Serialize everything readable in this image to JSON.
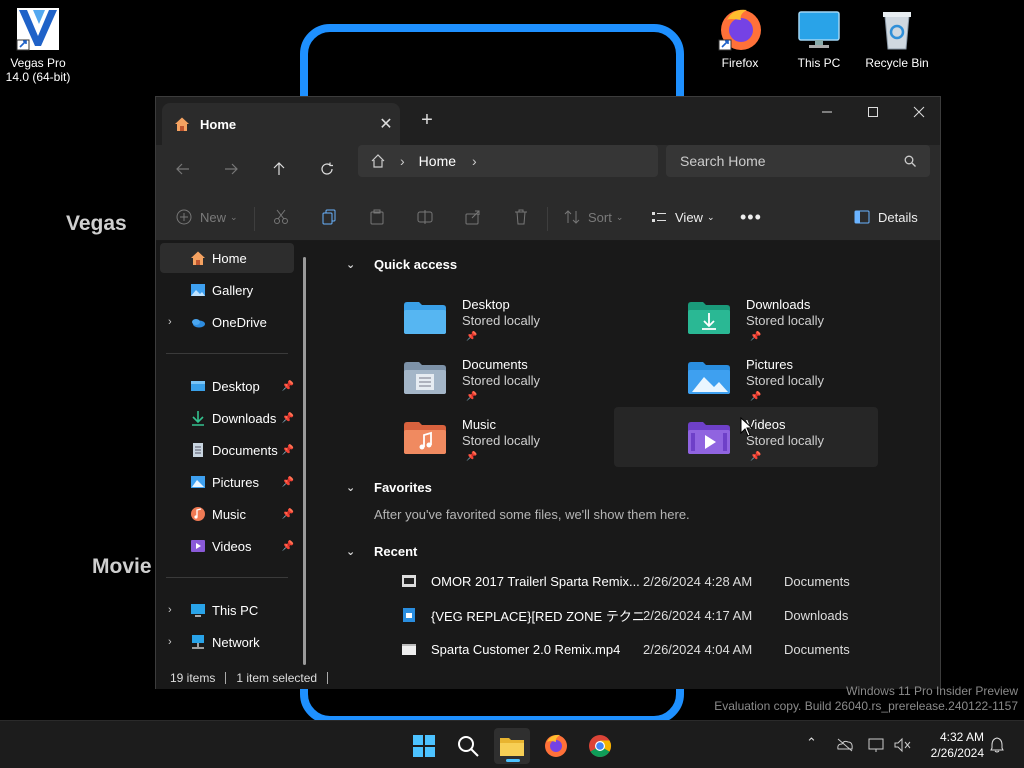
{
  "desktop": {
    "icons": {
      "vegas_label": "Vegas Pro\n14.0 (64-bit)",
      "vegas_line1": "Vegas Pro",
      "vegas_line2": "14.0 (64-bit)",
      "firefox": "Firefox",
      "this_pc": "This PC",
      "recycle_bin": "Recycle Bin"
    },
    "bg_text_vegas": "Vegas",
    "bg_text_movie": "Movie",
    "watermark_line1": "Windows 11 Pro Insider Preview",
    "watermark_line2": "Evaluation copy. Build 26040.rs_prerelease.240122-1157"
  },
  "window": {
    "tab_title": "Home",
    "breadcrumb_home": "Home",
    "search_placeholder": "Search Home",
    "commands": {
      "new": "New",
      "sort": "Sort",
      "view": "View",
      "details": "Details"
    }
  },
  "sidebar": {
    "items": [
      {
        "label": "Home",
        "icon": "home-icon"
      },
      {
        "label": "Gallery",
        "icon": "gallery-icon"
      },
      {
        "label": "OneDrive",
        "icon": "onedrive-icon"
      },
      {
        "label": "Desktop",
        "icon": "desktop-folder-icon"
      },
      {
        "label": "Downloads",
        "icon": "downloads-icon"
      },
      {
        "label": "Documents",
        "icon": "documents-icon"
      },
      {
        "label": "Pictures",
        "icon": "pictures-icon"
      },
      {
        "label": "Music",
        "icon": "music-icon"
      },
      {
        "label": "Videos",
        "icon": "videos-icon"
      },
      {
        "label": "This PC",
        "icon": "this-pc-icon"
      },
      {
        "label": "Network",
        "icon": "network-icon"
      }
    ]
  },
  "main": {
    "quick_access_title": "Quick access",
    "quick_access": [
      {
        "name": "Desktop",
        "sub": "Stored locally",
        "color": "#3aa0e8"
      },
      {
        "name": "Downloads",
        "sub": "Stored locally",
        "color": "#1fae8c"
      },
      {
        "name": "Documents",
        "sub": "Stored locally",
        "color": "#8fa6bf"
      },
      {
        "name": "Pictures",
        "sub": "Stored locally",
        "color": "#3ea0f0"
      },
      {
        "name": "Music",
        "sub": "Stored locally",
        "color": "#ef7a54"
      },
      {
        "name": "Videos",
        "sub": "Stored locally",
        "color": "#8a5ad8"
      }
    ],
    "favorites_title": "Favorites",
    "favorites_empty": "After you've favorited some files, we'll show them here.",
    "recent_title": "Recent",
    "recent": [
      {
        "name": "OMOR 2017 Trailerl Sparta Remix...",
        "date": "2/26/2024 4:28 AM",
        "location": "Documents"
      },
      {
        "name": "{VEG REPLACE}[RED ZONE テクニッ...",
        "date": "2/26/2024 4:17 AM",
        "location": "Downloads"
      },
      {
        "name": "Sparta Customer 2.0 Remix.mp4",
        "date": "2/26/2024 4:04 AM",
        "location": "Documents"
      }
    ]
  },
  "status": {
    "items": "19 items",
    "selected": "1 item selected"
  },
  "taskbar": {
    "time": "4:32 AM",
    "date": "2/26/2024"
  },
  "colors": {
    "accent": "#4cc2ff",
    "window_bg": "#191919",
    "bar_bg": "#2b2b2b"
  }
}
